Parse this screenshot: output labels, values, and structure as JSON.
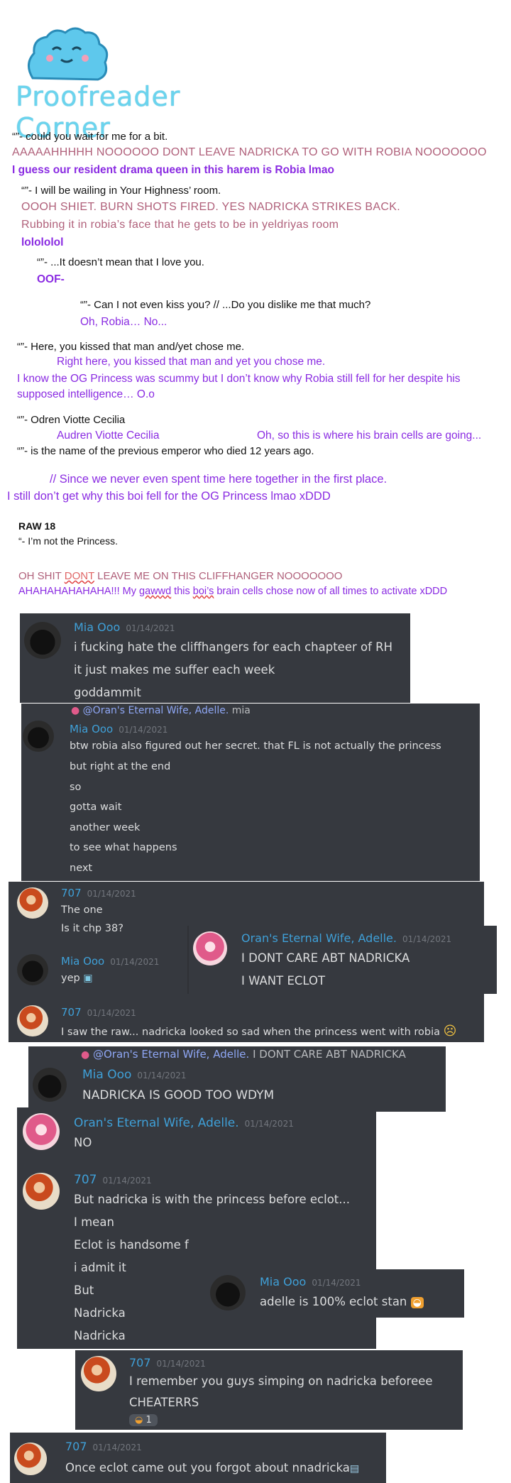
{
  "logo": {
    "title": "Proofreader Corner",
    "mascot": "blue-blob-mascot"
  },
  "lines": {
    "l1": "“”- could you wait for me for a bit.",
    "l2": "AAAAAHHHHH NOOOOOO DONT LEAVE NADRICKA TO GO WITH ROBIA NOOOOOOO",
    "l3": "I guess our resident drama queen in this harem is Robia lmao",
    "l4": "“”- I will be wailing in Your Highness’ room.",
    "l5": "OOOH SHIET. BURN  SHOTS FIRED. YES NADRICKA STRIKES BACK.",
    "l6": "Rubbing it in robia’s face that he gets to be in yeldriyas  room",
    "l7": "lolololol",
    "l8": "“”- ...It doesn’t mean that I love you.",
    "l9": "OOF-",
    "l10": "“”- Can I not even kiss you?  // ...Do you dislike me that much?",
    "l11": "Oh, Robia… No...",
    "l12": "“”- Here, you kissed that man and/yet chose me.",
    "l13": "Right here, you kissed that man and yet you chose me.",
    "l14a": "I know the OG Princess was scummy but I don’t know why Robia still fell for her despite his",
    "l14b": "supposed intelligence… O.o",
    "l15": "“”- Odren Viotte Cecilia",
    "l16a": "Audren Viotte Cecilia",
    "l16b": "Oh, so this is where his brain cells are going...",
    "l17": "“”- is the name of the previous emperor who died 12 years ago.",
    "l18": "// Since we never even spent time here together in the first place.",
    "l19": "I still don’t get why this boi fell for the OG Princess lmao xDDD",
    "raw": "RAW 18",
    "l20": "“- I’m not the Princess.",
    "l21a": "OH SHIT ",
    "l21b": "DONT",
    "l21c": " LEAVE ME ON THIS CLIFFHANGER NOOOOOOO",
    "l22a": "AHAHAHAHAHAHA!!! My ",
    "l22b": "gawwd",
    "l22c": " this ",
    "l22d": "boi’s",
    "l22e": " brain cells chose now of all times to activate xDDD"
  },
  "chat": {
    "c1": {
      "user": "Mia Ooo",
      "time": "01/14/2021",
      "m1": "i fucking hate the cliffhangers for each chapteer of RH",
      "m2": "it just makes me suffer each week",
      "m3": "goddammit"
    },
    "c2": {
      "reply_user": "@Oran's Eternal Wife, Adelle.",
      "reply_text": "mia",
      "user": "Mia Ooo",
      "time": "01/14/2021",
      "m1": "btw  robia  also figured out her secret. that FL is not actually  the princess",
      "m2": "but right at the end",
      "m3": "so",
      "m4": "gotta wait",
      "m5": "another  week",
      "m6": "to see what happens",
      "m7": "next"
    },
    "c3": {
      "user": "707",
      "time": "01/14/2021",
      "m1": "The one",
      "m2": "Is it chp 38?"
    },
    "c4": {
      "user": "Oran's Eternal Wife, Adelle.",
      "time": "01/14/2021",
      "m1": "I DONT CARE ABT NADRICKA",
      "m2": "I WANT ECLOT"
    },
    "c5": {
      "user": "Mia Ooo",
      "time": "01/14/2021",
      "m1": "yep"
    },
    "c6": {
      "user": "707",
      "time": "01/14/2021",
      "m1": "I saw the raw... nadricka looked so sad when the princess went with robia"
    },
    "c7": {
      "reply_user": "@Oran's Eternal Wife, Adelle.",
      "reply_text": "I DONT CARE ABT NADRICKA",
      "user": "Mia Ooo",
      "time": "01/14/2021",
      "m1": "NADRICKA IS  GOOD  TOO WDYM"
    },
    "c8": {
      "user": "Oran's Eternal Wife, Adelle.",
      "time": "01/14/2021",
      "m1": "NO"
    },
    "c9": {
      "user": "707",
      "time": "01/14/2021",
      "m1": "But nadricka is with the princess before eclot...",
      "m2": "I mean",
      "m3": "Eclot is handsome f",
      "m4": "i admit it",
      "m5": "But",
      "m6": "Nadricka",
      "m7": "Nadricka"
    },
    "c10": {
      "user": "Mia Ooo",
      "time": "01/14/2021",
      "m1": "adelle is 100% eclot stan"
    },
    "c11": {
      "user": "707",
      "time": "01/14/2021",
      "m1": "I remember you guys simping on nadricka beforeee",
      "m2": "CHEATERRS",
      "reaction_count": "1"
    },
    "c12": {
      "user": "707",
      "time": "01/14/2021",
      "m1": "Once eclot came out you forgot about nnadricka"
    }
  },
  "colors": {
    "discord_bg": "#36393f",
    "username_blue": "#3fa0d8",
    "purple_text": "#8a2be2",
    "pink_text": "#b0607a"
  }
}
